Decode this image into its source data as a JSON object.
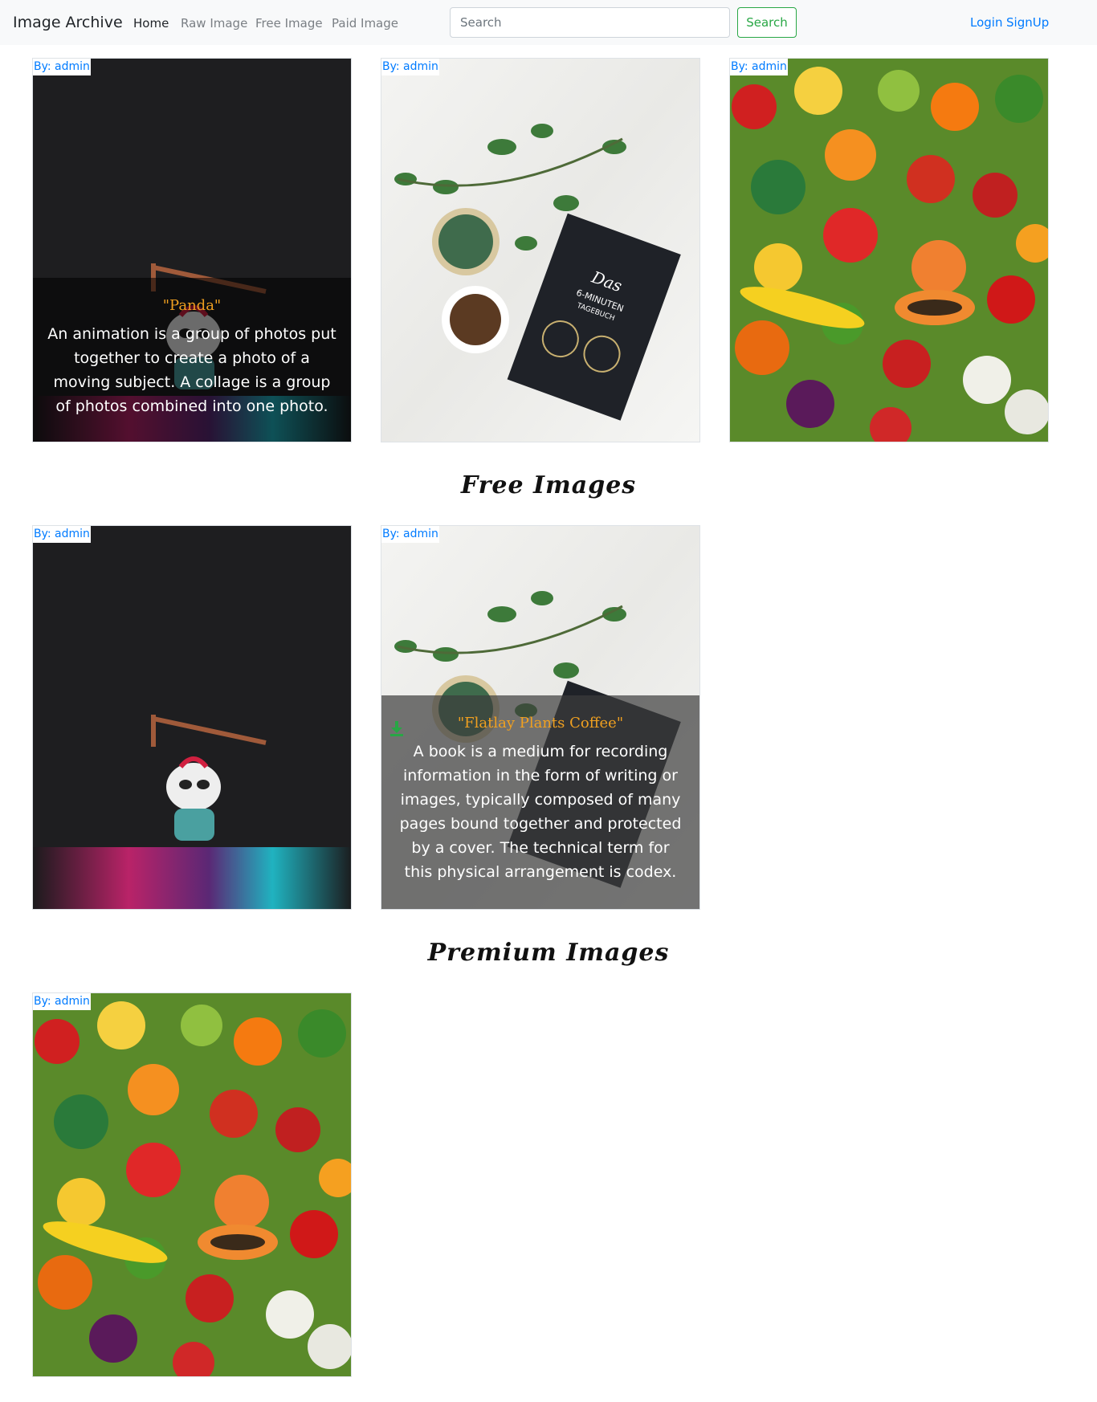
{
  "navbar": {
    "brand": "Image Archive",
    "links": [
      "Home",
      "Raw Image",
      "Free Image",
      "Paid Image"
    ],
    "search_placeholder": "Search",
    "search_button": "Search",
    "login": "Login",
    "signup": "SignUp"
  },
  "raw_images": {
    "cards": [
      {
        "author": "By: admin",
        "title": "\"Panda\"",
        "description": "An animation is a group of photos put together to create a photo of a moving subject. A collage is a group of photos combined into one photo.",
        "image": "panda-figurine-photo"
      },
      {
        "author": "By: admin",
        "image": "flatlay-plants-coffee-photo"
      },
      {
        "author": "By: admin",
        "image": "fruits-vegetables-photo"
      }
    ]
  },
  "free_images": {
    "heading": "Free Images",
    "cards": [
      {
        "author": "By: admin",
        "image": "panda-figurine-photo"
      },
      {
        "author": "By: admin",
        "title": "\"Flatlay Plants Coffee\"",
        "description": "A book is a medium for recording information in the form of writing or images, typically composed of many pages bound together and protected by a cover. The technical term for this physical arrangement is codex.",
        "image": "flatlay-plants-coffee-photo",
        "icon": "download-icon"
      }
    ]
  },
  "premium_images": {
    "heading": "Premium Images",
    "cards": [
      {
        "author": "By: admin",
        "image": "fruits-vegetables-photo"
      }
    ]
  },
  "colors": {
    "link": "#007bff",
    "success": "#28a745",
    "overlay_title": "#f0a020",
    "navbar_bg": "#f8f9fa"
  }
}
